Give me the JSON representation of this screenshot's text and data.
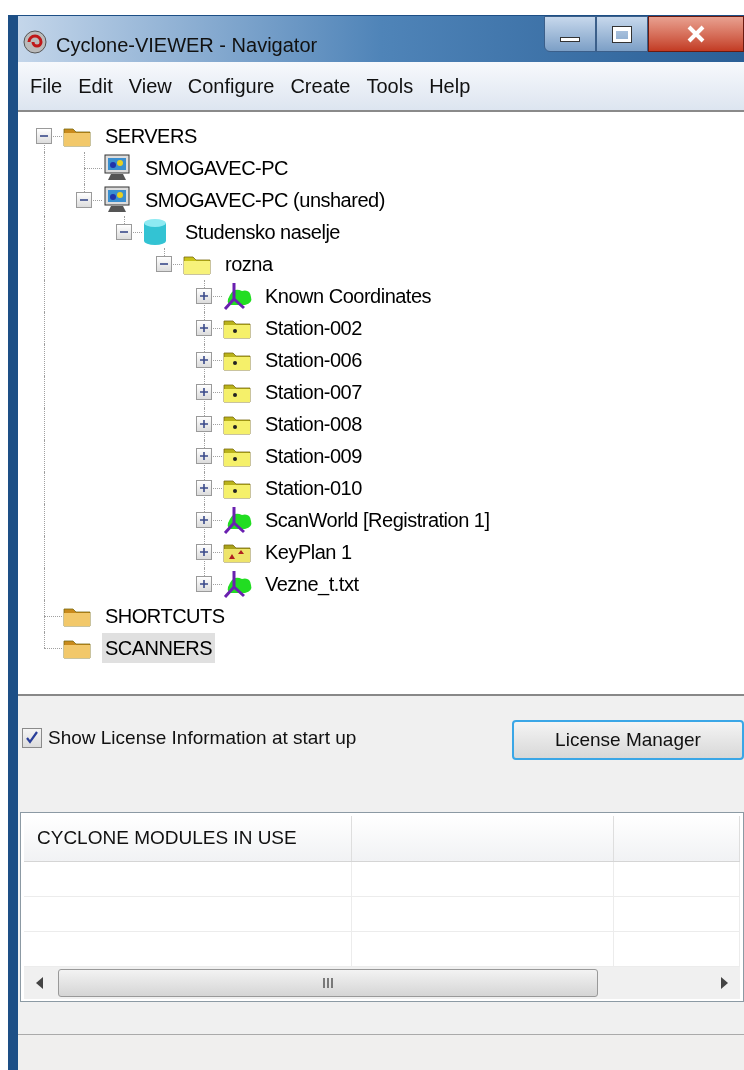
{
  "window": {
    "title": "Cyclone-VIEWER - Navigator"
  },
  "menu": [
    "File",
    "Edit",
    "View",
    "Configure",
    "Create",
    "Tools",
    "Help"
  ],
  "tree": [
    {
      "label": "SERVERS",
      "kind": "server-folder",
      "expanded": true,
      "selected": false,
      "children": [
        {
          "label": "SMOGAVEC-PC",
          "kind": "computer",
          "selected": false
        },
        {
          "label": "SMOGAVEC-PC (unshared)",
          "kind": "computer",
          "expanded": true,
          "selected": false,
          "children": [
            {
              "label": "Studensko naselje",
              "kind": "database",
              "expanded": true,
              "selected": false,
              "children": [
                {
                  "label": "rozna",
                  "kind": "folder",
                  "expanded": true,
                  "selected": false,
                  "children": [
                    {
                      "label": "Known Coordinates",
                      "kind": "scanworld",
                      "expanded": false,
                      "selected": false
                    },
                    {
                      "label": "Station-002",
                      "kind": "station",
                      "expanded": false,
                      "selected": false
                    },
                    {
                      "label": "Station-006",
                      "kind": "station",
                      "expanded": false,
                      "selected": false
                    },
                    {
                      "label": "Station-007",
                      "kind": "station",
                      "expanded": false,
                      "selected": false
                    },
                    {
                      "label": "Station-008",
                      "kind": "station",
                      "expanded": false,
                      "selected": false
                    },
                    {
                      "label": "Station-009",
                      "kind": "station",
                      "expanded": false,
                      "selected": false
                    },
                    {
                      "label": "Station-010",
                      "kind": "station",
                      "expanded": false,
                      "selected": false
                    },
                    {
                      "label": "ScanWorld [Registration 1]",
                      "kind": "scanworld",
                      "expanded": false,
                      "selected": false
                    },
                    {
                      "label": "KeyPlan 1",
                      "kind": "keyplan",
                      "expanded": false,
                      "selected": false
                    },
                    {
                      "label": "Vezne_t.txt",
                      "kind": "scanworld",
                      "expanded": false,
                      "selected": false
                    }
                  ]
                }
              ]
            }
          ]
        }
      ]
    },
    {
      "label": "SHORTCUTS",
      "kind": "server-folder",
      "selected": false
    },
    {
      "label": "SCANNERS",
      "kind": "server-folder",
      "selected": true
    }
  ],
  "license_checkbox": {
    "label": "Show License Information at start up",
    "checked": true
  },
  "license_button": "License Manager",
  "modules_table": {
    "columns": [
      "CYCLONE MODULES IN USE"
    ]
  }
}
